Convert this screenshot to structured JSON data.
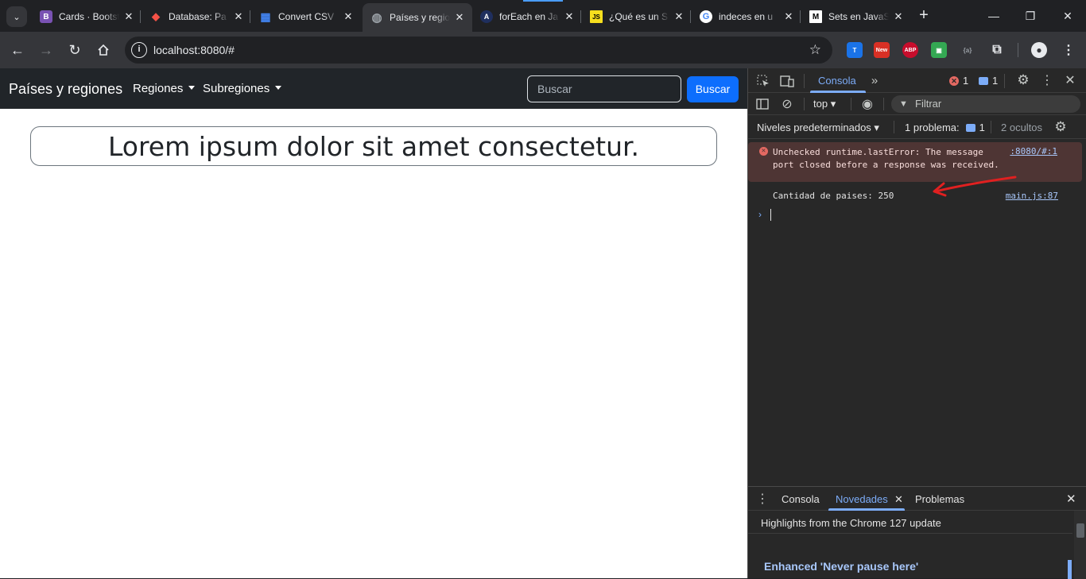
{
  "browser": {
    "tabs": [
      {
        "title": "Cards · Bootstrap",
        "favicon": "bootstrap-icon",
        "favicon_color": "#7952b3",
        "favicon_text": "B"
      },
      {
        "title": "Database: Pa",
        "favicon": "laravel-icon",
        "favicon_color": "#f55247",
        "favicon_text": "◆"
      },
      {
        "title": "Convert CSV",
        "favicon": "grid-icon",
        "favicon_color": "#4285f4",
        "favicon_text": "▦"
      },
      {
        "title": "Países y regiones",
        "favicon": "globe-icon",
        "favicon_color": "#9aa0a6",
        "favicon_text": "◍",
        "active": true
      },
      {
        "title": "forEach en Ja",
        "favicon": "a-logo-icon",
        "favicon_color": "#1f2f5e",
        "favicon_text": "A"
      },
      {
        "title": "¿Qué es un S",
        "favicon": "js-icon",
        "favicon_color": "#f7df1e",
        "favicon_text": "JS"
      },
      {
        "title": "indeces en u",
        "favicon": "google-icon",
        "favicon_color": "#ffffff",
        "favicon_text": "G"
      },
      {
        "title": "Sets en JavaS",
        "favicon": "medium-icon",
        "favicon_color": "#ffffff",
        "favicon_text": "M"
      }
    ],
    "url": "localhost:8080/#",
    "extensions": [
      {
        "name": "translate-extension-icon",
        "color": "#1a73e8",
        "label": "T"
      },
      {
        "name": "new-badge-extension-icon",
        "color": "#d93025",
        "label": "New"
      },
      {
        "name": "adblock-plus-icon",
        "color": "#c70d2c",
        "label": "ABP"
      },
      {
        "name": "android-extension-icon",
        "color": "#34a853",
        "label": "▣"
      },
      {
        "name": "json-viewer-icon",
        "color": "#3c4043",
        "label": "{a}"
      }
    ]
  },
  "page": {
    "brand": "Países y regiones",
    "nav": {
      "regiones": "Regiones",
      "subregiones": "Subregiones"
    },
    "search": {
      "placeholder": "Buscar",
      "button": "Buscar"
    },
    "headline": "Lorem ipsum dolor sit amet consectetur."
  },
  "devtools": {
    "panel_tab": "Consola",
    "error_count": "1",
    "message_count": "1",
    "context": "top",
    "filter_placeholder": "Filtrar",
    "levels": "Niveles predeterminados",
    "issues_label": "1 problema:",
    "issues_count": "1",
    "hidden": "2 ocultos",
    "messages": [
      {
        "level": "error",
        "text": "Unchecked runtime.lastError: The message port closed before a response was received.",
        "source": ":8080/#:1"
      },
      {
        "level": "log",
        "text": "Cantidad de paises: 250",
        "source": "main.js:87"
      }
    ],
    "drawer": {
      "tabs": [
        "Consola",
        "Novedades",
        "Problemas"
      ],
      "active": "Novedades",
      "highlight": "Highlights from the Chrome 127 update",
      "feature": "Enhanced 'Never pause here'"
    }
  },
  "colors": {
    "accent": "#0d6efd",
    "devtools_accent": "#7cacf8",
    "error_bg": "#4e3534",
    "annotation": "#e02020"
  }
}
